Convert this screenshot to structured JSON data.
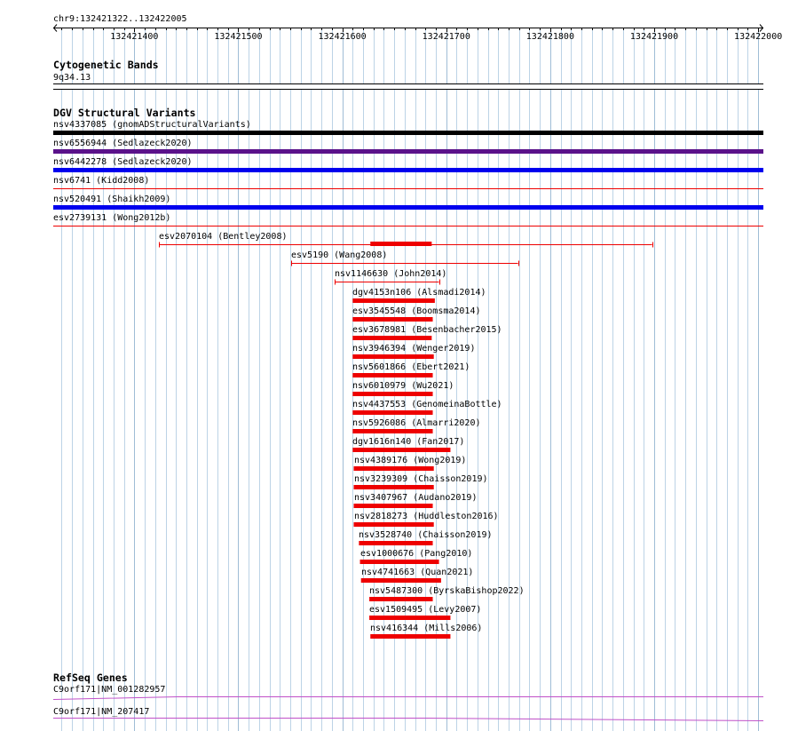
{
  "view": {
    "location_label": "chr9:132421322..132422005",
    "start": 132421322,
    "end": 132422005
  },
  "ruler": {
    "ticks": [
      132421400,
      132421500,
      132421600,
      132421700,
      132421800,
      132421900,
      132422000
    ]
  },
  "tracks": {
    "cytoband": {
      "title": "Cytogenetic Bands",
      "band": {
        "label": "9q34.13",
        "start": 132421322,
        "end": 132422005,
        "fill": "#ffffff",
        "outline": "#000000"
      }
    },
    "dgv": {
      "title": "DGV Structural Variants",
      "features": [
        {
          "label": "nsv4337085 (gnomADStructuralVariants)",
          "start": 132421322,
          "end": 132422005,
          "thick": true,
          "color": "#000000"
        },
        {
          "label": "nsv6556944 (Sedlazeck2020)",
          "start": 132421322,
          "end": 132422005,
          "thick": true,
          "color": "#5a128a"
        },
        {
          "label": "nsv6442278 (Sedlazeck2020)",
          "start": 132421322,
          "end": 132422005,
          "thick": true,
          "color": "#0000ee"
        },
        {
          "label": "nsv6741 (Kidd2008)",
          "start": 132421322,
          "end": 132422005,
          "thick": false,
          "color": "#ee0000"
        },
        {
          "label": "nsv520491 (Shaikh2009)",
          "start": 132421322,
          "end": 132422005,
          "thick": true,
          "color": "#0000ee"
        },
        {
          "label": "esv2739131 (Wong2012b)",
          "start": 132421322,
          "end": 132422005,
          "thick": false,
          "color": "#ee0000"
        },
        {
          "label": "esv2070104 (Bentley2008)",
          "start": 132421424,
          "end": 132421898,
          "inner_start": 132421627,
          "inner_end": 132421686,
          "thick": false,
          "color": "#ee0000"
        },
        {
          "label": "esv5190 (Wang2008)",
          "start": 132421551,
          "end": 132421769,
          "thick": false,
          "color": "#ee0000"
        },
        {
          "label": "nsv1146630 (John2014)",
          "start": 132421593,
          "end": 132421693,
          "thick": false,
          "color": "#ee0000"
        },
        {
          "label": "dgv4153n106 (Alsmadi2014)",
          "start": 132421610,
          "end": 132421689,
          "thick": true,
          "color": "#ee0000"
        },
        {
          "label": "esv3545548 (Boomsma2014)",
          "start": 132421610,
          "end": 132421687,
          "thick": true,
          "color": "#ee0000"
        },
        {
          "label": "esv3678981 (Besenbacher2015)",
          "start": 132421610,
          "end": 132421686,
          "thick": true,
          "color": "#ee0000"
        },
        {
          "label": "nsv3946394 (Wenger2019)",
          "start": 132421610,
          "end": 132421688,
          "thick": true,
          "color": "#ee0000"
        },
        {
          "label": "nsv5601866 (Ebert2021)",
          "start": 132421610,
          "end": 132421687,
          "thick": true,
          "color": "#ee0000"
        },
        {
          "label": "nsv6010979 (Wu2021)",
          "start": 132421610,
          "end": 132421687,
          "thick": true,
          "color": "#ee0000"
        },
        {
          "label": "nsv4437553 (GenomeinaBottle)",
          "start": 132421610,
          "end": 132421687,
          "thick": true,
          "color": "#ee0000"
        },
        {
          "label": "nsv5926086 (Almarri2020)",
          "start": 132421610,
          "end": 132421687,
          "thick": true,
          "color": "#ee0000"
        },
        {
          "label": "dgv1616n140 (Fan2017)",
          "start": 132421610,
          "end": 132421704,
          "thick": true,
          "color": "#ee0000"
        },
        {
          "label": "nsv4389176 (Wong2019)",
          "start": 132421611,
          "end": 132421688,
          "thick": true,
          "color": "#ee0000"
        },
        {
          "label": "nsv3239309 (Chaisson2019)",
          "start": 132421611,
          "end": 132421688,
          "thick": true,
          "color": "#ee0000"
        },
        {
          "label": "nsv3407967 (Audano2019)",
          "start": 132421611,
          "end": 132421687,
          "thick": true,
          "color": "#ee0000"
        },
        {
          "label": "nsv2818273 (Huddleston2016)",
          "start": 132421611,
          "end": 132421688,
          "thick": true,
          "color": "#ee0000"
        },
        {
          "label": "nsv3528740 (Chaisson2019)",
          "start": 132421616,
          "end": 132421687,
          "thick": true,
          "color": "#ee0000"
        },
        {
          "label": "esv1000676 (Pang2010)",
          "start": 132421617,
          "end": 132421693,
          "thick": true,
          "color": "#ee0000"
        },
        {
          "label": "nsv4741663 (Quan2021)",
          "start": 132421618,
          "end": 132421695,
          "thick": true,
          "color": "#ee0000"
        },
        {
          "label": "nsv5487300 (ByrskaBishop2022)",
          "start": 132421626,
          "end": 132421687,
          "thick": true,
          "color": "#ee0000"
        },
        {
          "label": "esv1509495 (Levy2007)",
          "start": 132421626,
          "end": 132421704,
          "thick": true,
          "color": "#ee0000"
        },
        {
          "label": "nsv416344 (Mills2006)",
          "start": 132421627,
          "end": 132421704,
          "thick": true,
          "color": "#ee0000"
        }
      ]
    },
    "refseq": {
      "title": "RefSeq Genes",
      "transcripts": [
        {
          "label": "C9orf171|NM_001282957",
          "start": 132421322,
          "end": 132422005,
          "color": "#c050c8"
        },
        {
          "label": "C9orf171|NM_207417",
          "start": 132421322,
          "end": 132422005,
          "color": "#c050c8"
        }
      ]
    }
  }
}
